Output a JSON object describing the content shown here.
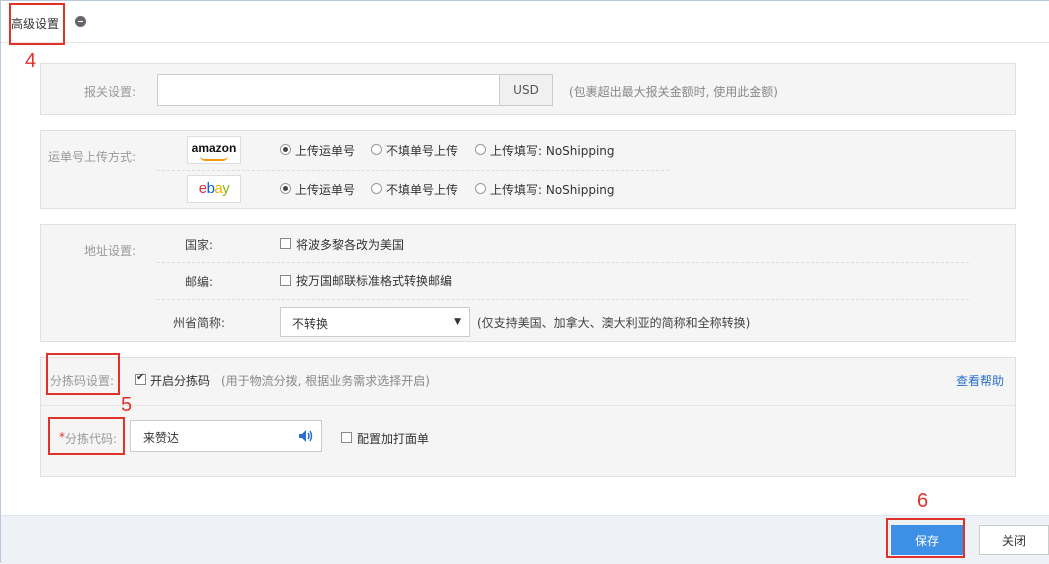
{
  "header": {
    "title": "高级设置"
  },
  "annotations": {
    "n4": "4",
    "n5": "5",
    "n6": "6"
  },
  "customs": {
    "label": "报关设置:",
    "value": "",
    "currency": "USD",
    "hint": "(包裹超出最大报关金额时, 使用此金额)"
  },
  "tracking": {
    "label": "运单号上传方式:",
    "platforms": [
      {
        "name": "amazon",
        "options": [
          "上传运单号",
          "不填单号上传",
          "上传填写: NoShipping"
        ],
        "selected": 0
      },
      {
        "name": "ebay",
        "options": [
          "上传运单号",
          "不填单号上传",
          "上传填写: NoShipping"
        ],
        "selected": 0
      }
    ]
  },
  "address": {
    "label": "地址设置:",
    "country_label": "国家:",
    "country_option": "将波多黎各改为美国",
    "zip_label": "邮编:",
    "zip_option": "按万国邮联标准格式转换邮编",
    "state_label": "州省简称:",
    "state_value": "不转换",
    "state_hint": "(仅支持美国、加拿大、澳大利亚的简称和全称转换)"
  },
  "sorting": {
    "label": "分拣码设置:",
    "enable_label": "开启分拣码",
    "enable_hint": "(用于物流分拨, 根据业务需求选择开启)",
    "help_link": "查看帮助",
    "code_required_mark": "*",
    "code_label": "分拣代码:",
    "code_value": "来赞达",
    "print_option": "配置加打面单"
  },
  "footer": {
    "save": "保存",
    "close": "关闭"
  },
  "colors": {
    "accent": "#3e8fe6",
    "annotation": "#e0322a",
    "link": "#2a6fc9"
  }
}
